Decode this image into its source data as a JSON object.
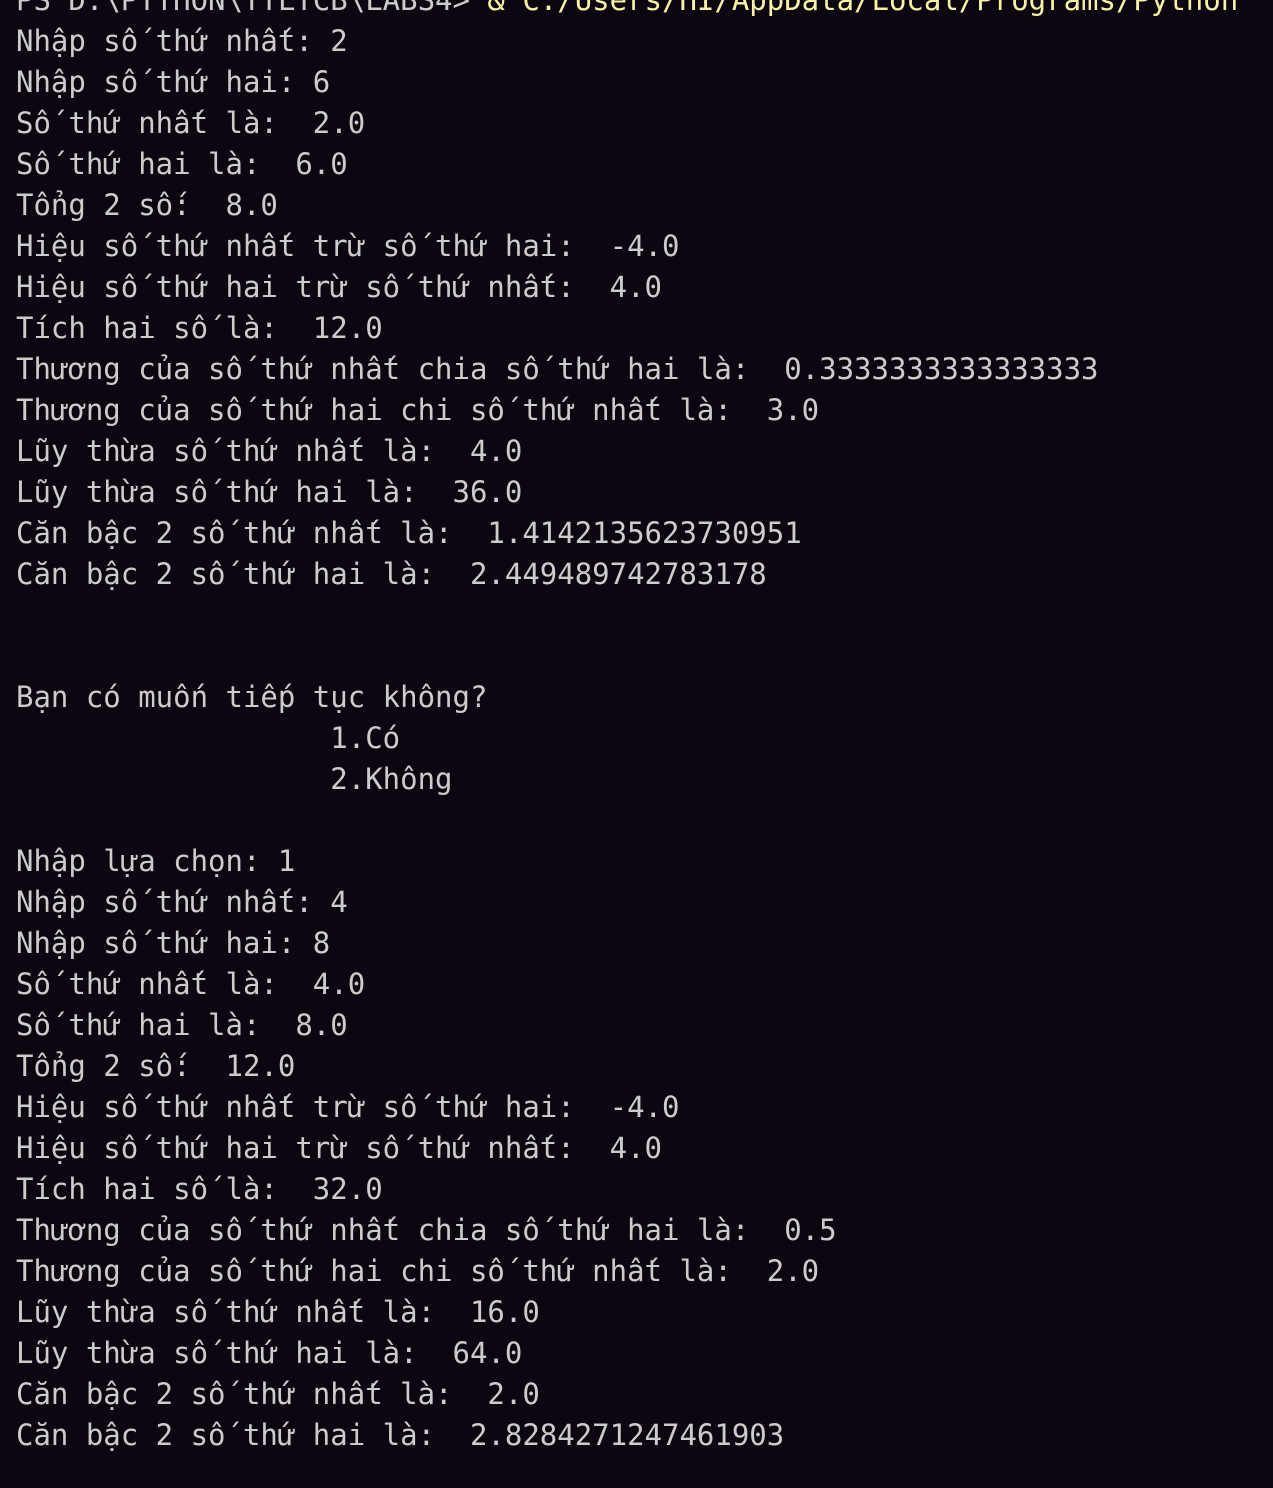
{
  "terminal": {
    "prompt": {
      "path": "PS D:\\PYTHON\\TTLTCB\\LABS4> ",
      "command": "& C:/Users/HI/AppData/Local/Programs/Python"
    },
    "lines": [
      "Nhập số thứ nhất: 2",
      "Nhập số thứ hai: 6",
      "Số thứ nhất là:  2.0",
      "Số thứ hai là:  6.0",
      "Tổng 2 số:  8.0",
      "Hiệu số thứ nhất trừ số thứ hai:  -4.0",
      "Hiệu số thứ hai trừ số thứ nhất:  4.0",
      "Tích hai số là:  12.0",
      "Thương của số thứ nhất chia số thứ hai là:  0.3333333333333333",
      "Thương của số thứ hai chi số thứ nhất là:  3.0",
      "Lũy thừa số thứ nhất là:  4.0",
      "Lũy thừa số thứ hai là:  36.0",
      "Căn bậc 2 số thứ nhất là:  1.4142135623730951",
      "Căn bậc 2 số thứ hai là:  2.449489742783178",
      "",
      "",
      "Bạn có muốn tiếp tục không?",
      "                  1.Có",
      "                  2.Không",
      "",
      "Nhập lựa chọn: 1",
      "Nhập số thứ nhất: 4",
      "Nhập số thứ hai: 8",
      "Số thứ nhất là:  4.0",
      "Số thứ hai là:  8.0",
      "Tổng 2 số:  12.0",
      "Hiệu số thứ nhất trừ số thứ hai:  -4.0",
      "Hiệu số thứ hai trừ số thứ nhất:  4.0",
      "Tích hai số là:  32.0",
      "Thương của số thứ nhất chia số thứ hai là:  0.5",
      "Thương của số thứ hai chi số thứ nhất là:  2.0",
      "Lũy thừa số thứ nhất là:  16.0",
      "Lũy thừa số thứ hai là:  64.0",
      "Căn bậc 2 số thứ nhất là:  2.0",
      "Căn bậc 2 số thứ hai là:  2.8284271247461903"
    ]
  }
}
